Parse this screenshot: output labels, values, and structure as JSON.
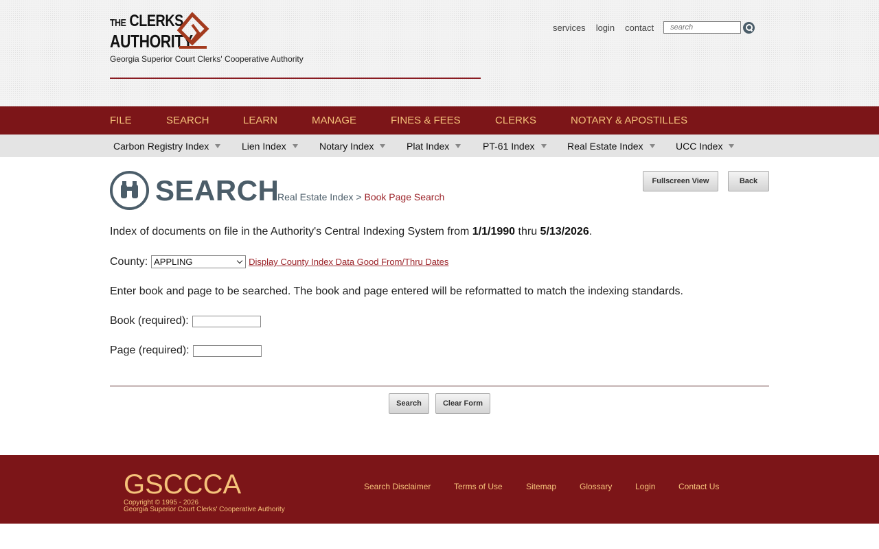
{
  "header": {
    "logo_line1_small": "THE",
    "logo_line1": "CLERKS",
    "logo_line2": "AUTHORITY",
    "tagline": "Georgia Superior Court Clerks' Cooperative Authority",
    "links": {
      "services": "services",
      "login": "login",
      "contact": "contact"
    },
    "search_placeholder": "search"
  },
  "main_nav": [
    "FILE",
    "SEARCH",
    "LEARN",
    "MANAGE",
    "FINES & FEES",
    "CLERKS",
    "NOTARY & APOSTILLES"
  ],
  "sub_nav": [
    "Carbon Registry Index",
    "Lien Index",
    "Notary Index",
    "Plat Index",
    "PT-61 Index",
    "Real Estate Index",
    "UCC Index"
  ],
  "page": {
    "heading": "SEARCH",
    "breadcrumb_parent": "Real Estate Index",
    "breadcrumb_sep": ">",
    "breadcrumb_current": "Book Page Search",
    "fullscreen_label": "Fullscreen View",
    "back_label": "Back",
    "intro_prefix": "Index of documents on file in the Authority's Central Indexing System from",
    "intro_from": "1/1/1990",
    "intro_thru_word": "thru",
    "intro_to": "5/13/2026",
    "intro_suffix": ".",
    "county_label": "County:",
    "county_value": "APPLING",
    "county_link": "Display County Index Data Good From/Thru Dates",
    "instructions": "Enter book and page to be searched. The book and page entered will be reformatted to match the indexing standards.",
    "book_label": "Book (required):",
    "book_value": "",
    "page_label": "Page (required):",
    "page_value": "",
    "search_label": "Search",
    "clear_label": "Clear Form"
  },
  "footer": {
    "brand": "GSCCCA",
    "copyright": "Copyright © 1995 - 2026",
    "org": "Georgia Superior Court Clerks' Cooperative Authority",
    "links": [
      "Search Disclaimer",
      "Terms of Use",
      "Sitemap",
      "Glossary",
      "Login",
      "Contact Us"
    ]
  },
  "colors": {
    "brand_red": "#7c1518",
    "accent_gold": "#f5c27a",
    "slate": "#4b5d69",
    "link_red": "#9b2228"
  },
  "icons": [
    "logo-mark-icon",
    "search-icon",
    "dropdown-triangle-icon",
    "binoculars-icon",
    "select-chevron-icon"
  ]
}
